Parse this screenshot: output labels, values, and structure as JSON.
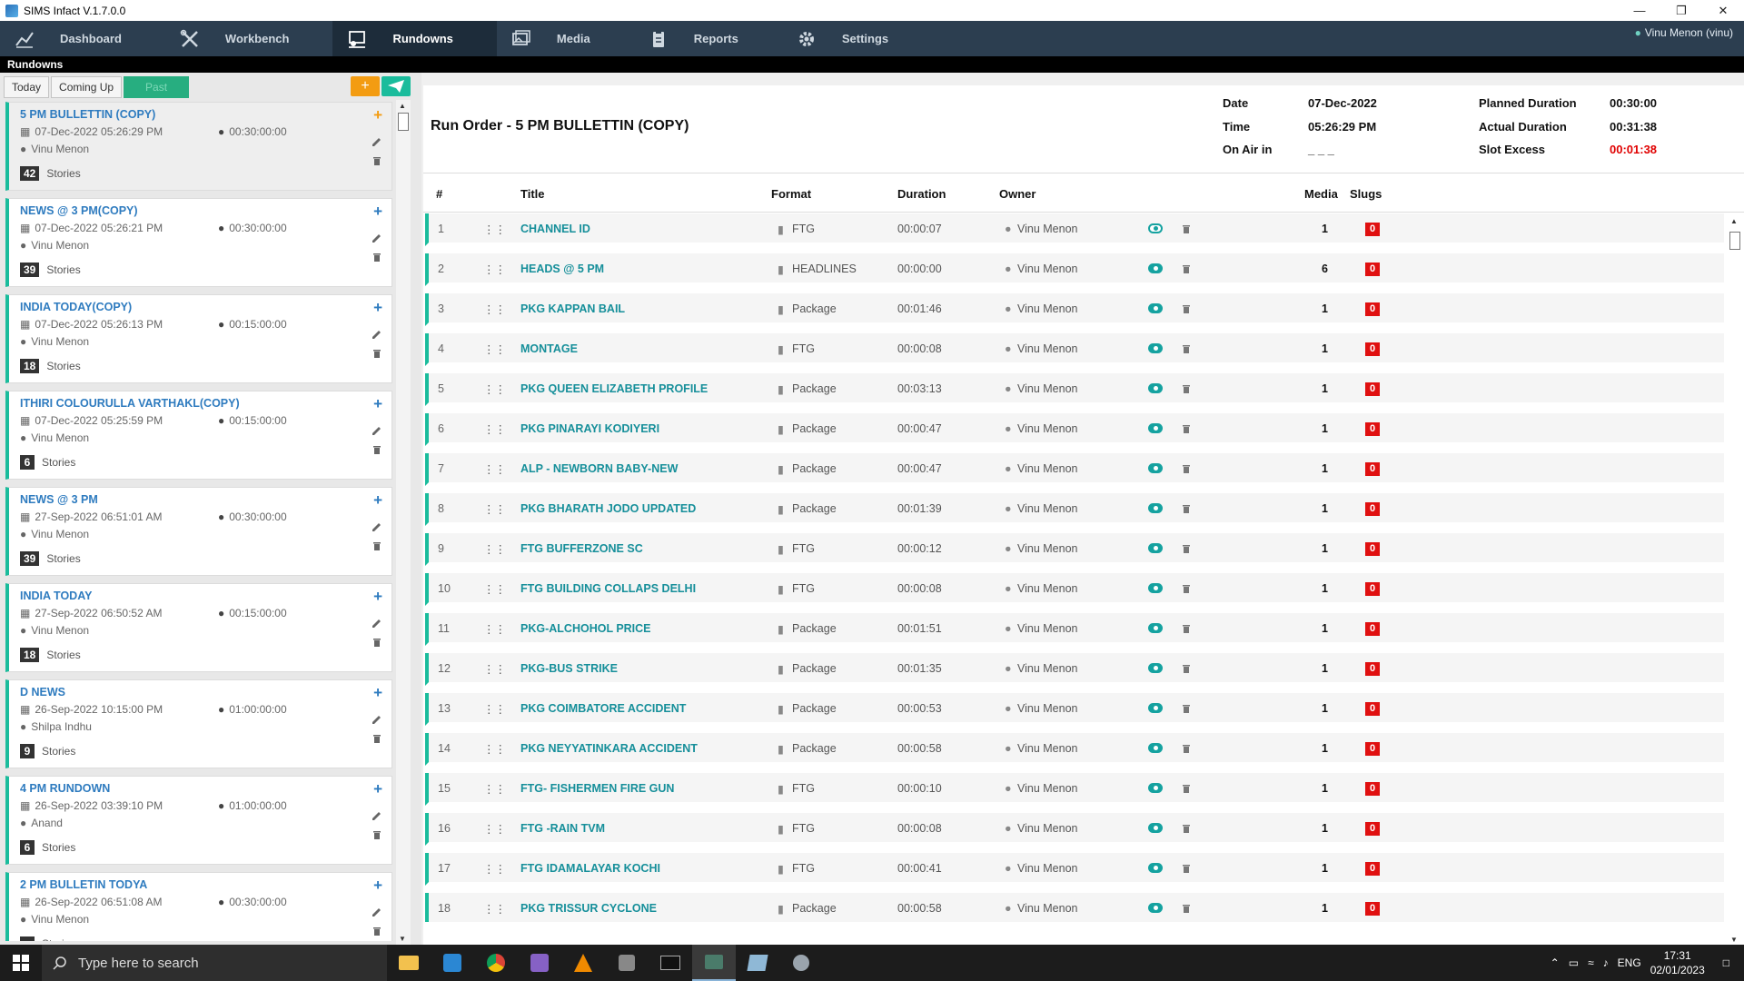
{
  "window": {
    "title": "SIMS Infact V.1.7.0.0"
  },
  "nav": {
    "items": [
      {
        "label": "Dashboard",
        "icon": "chart-icon"
      },
      {
        "label": "Workbench",
        "icon": "tools-icon"
      },
      {
        "label": "Rundowns",
        "icon": "rundown-icon"
      },
      {
        "label": "Media",
        "icon": "media-icon"
      },
      {
        "label": "Reports",
        "icon": "report-icon"
      },
      {
        "label": "Settings",
        "icon": "gear-icon"
      }
    ],
    "active": "Rundowns",
    "user": "Vinu Menon (vinu)"
  },
  "section_title": "Rundowns",
  "left": {
    "tabs": [
      "Today",
      "Coming Up",
      "Past"
    ],
    "add_label": "+",
    "stories_label": "Stories",
    "rundowns": [
      {
        "title": "5 PM BULLETTIN (COPY)",
        "date": "07-Dec-2022 05:26:29 PM",
        "duration": "00:30:00:00",
        "owner": "Vinu Menon",
        "stories": "42"
      },
      {
        "title": "NEWS @ 3 PM(COPY)",
        "date": "07-Dec-2022 05:26:21 PM",
        "duration": "00:30:00:00",
        "owner": "Vinu Menon",
        "stories": "39"
      },
      {
        "title": "INDIA TODAY(COPY)",
        "date": "07-Dec-2022 05:26:13 PM",
        "duration": "00:15:00:00",
        "owner": "Vinu Menon",
        "stories": "18"
      },
      {
        "title": "ITHIRI COLOURULLA VARTHAKL(COPY)",
        "date": "07-Dec-2022 05:25:59 PM",
        "duration": "00:15:00:00",
        "owner": "Vinu Menon",
        "stories": "6"
      },
      {
        "title": "NEWS @ 3 PM",
        "date": "27-Sep-2022 06:51:01 AM",
        "duration": "00:30:00:00",
        "owner": "Vinu Menon",
        "stories": "39"
      },
      {
        "title": "INDIA TODAY",
        "date": "27-Sep-2022 06:50:52 AM",
        "duration": "00:15:00:00",
        "owner": "Vinu Menon",
        "stories": "18"
      },
      {
        "title": "D NEWS",
        "date": "26-Sep-2022 10:15:00 PM",
        "duration": "01:00:00:00",
        "owner": "Shilpa Indhu",
        "stories": "9"
      },
      {
        "title": "4 PM RUNDOWN",
        "date": "26-Sep-2022 03:39:10 PM",
        "duration": "01:00:00:00",
        "owner": "Anand",
        "stories": "6"
      },
      {
        "title": "2 PM BULLETIN TODYA",
        "date": "26-Sep-2022 06:51:08 AM",
        "duration": "00:30:00:00",
        "owner": "Vinu Menon",
        "stories": ""
      }
    ]
  },
  "runorder": {
    "title": "Run Order - 5 PM BULLETTIN (COPY)",
    "date_label": "Date",
    "date": "07-Dec-2022",
    "time_label": "Time",
    "time": "05:26:29 PM",
    "onair_label": "On Air in",
    "onair": "_ _ _",
    "planned_label": "Planned Duration",
    "planned": "00:30:00",
    "actual_label": "Actual Duration",
    "actual": "00:31:38",
    "excess_label": "Slot Excess",
    "excess": "00:01:38",
    "columns": {
      "num": "#",
      "title": "Title",
      "format": "Format",
      "duration": "Duration",
      "owner": "Owner",
      "media": "Media",
      "slugs": "Slugs"
    },
    "stories": [
      {
        "n": "1",
        "title": "CHANNEL ID",
        "format": "FTG",
        "duration": "00:00:07",
        "owner": "Vinu Menon",
        "media": "1",
        "slugs": "0"
      },
      {
        "n": "2",
        "title": "HEADS @ 5 PM",
        "format": "HEADLINES",
        "duration": "00:00:00",
        "owner": "Vinu Menon",
        "media": "6",
        "slugs": "0"
      },
      {
        "n": "3",
        "title": "PKG KAPPAN BAIL",
        "format": "Package",
        "duration": "00:01:46",
        "owner": "Vinu Menon",
        "media": "1",
        "slugs": "0"
      },
      {
        "n": "4",
        "title": "MONTAGE",
        "format": "FTG",
        "duration": "00:00:08",
        "owner": "Vinu Menon",
        "media": "1",
        "slugs": "0"
      },
      {
        "n": "5",
        "title": "PKG QUEEN ELIZABETH PROFILE",
        "format": "Package",
        "duration": "00:03:13",
        "owner": "Vinu Menon",
        "media": "1",
        "slugs": "0"
      },
      {
        "n": "6",
        "title": "PKG PINARAYI KODIYERI",
        "format": "Package",
        "duration": "00:00:47",
        "owner": "Vinu Menon",
        "media": "1",
        "slugs": "0"
      },
      {
        "n": "7",
        "title": "ALP - NEWBORN BABY-NEW",
        "format": "Package",
        "duration": "00:00:47",
        "owner": "Vinu Menon",
        "media": "1",
        "slugs": "0"
      },
      {
        "n": "8",
        "title": "PKG BHARATH JODO UPDATED",
        "format": "Package",
        "duration": "00:01:39",
        "owner": "Vinu Menon",
        "media": "1",
        "slugs": "0"
      },
      {
        "n": "9",
        "title": "FTG BUFFERZONE SC",
        "format": "FTG",
        "duration": "00:00:12",
        "owner": "Vinu Menon",
        "media": "1",
        "slugs": "0"
      },
      {
        "n": "10",
        "title": "FTG BUILDING COLLAPS DELHI",
        "format": "FTG",
        "duration": "00:00:08",
        "owner": "Vinu Menon",
        "media": "1",
        "slugs": "0"
      },
      {
        "n": "11",
        "title": "PKG-ALCHOHOL PRICE",
        "format": "Package",
        "duration": "00:01:51",
        "owner": "Vinu Menon",
        "media": "1",
        "slugs": "0"
      },
      {
        "n": "12",
        "title": "PKG-BUS STRIKE",
        "format": "Package",
        "duration": "00:01:35",
        "owner": "Vinu Menon",
        "media": "1",
        "slugs": "0"
      },
      {
        "n": "13",
        "title": "PKG COIMBATORE ACCIDENT",
        "format": "Package",
        "duration": "00:00:53",
        "owner": "Vinu Menon",
        "media": "1",
        "slugs": "0"
      },
      {
        "n": "14",
        "title": "PKG NEYYATINKARA ACCIDENT",
        "format": "Package",
        "duration": "00:00:58",
        "owner": "Vinu Menon",
        "media": "1",
        "slugs": "0"
      },
      {
        "n": "15",
        "title": "FTG- FISHERMEN FIRE GUN",
        "format": "FTG",
        "duration": "00:00:10",
        "owner": "Vinu Menon",
        "media": "1",
        "slugs": "0"
      },
      {
        "n": "16",
        "title": "FTG -RAIN TVM",
        "format": "FTG",
        "duration": "00:00:08",
        "owner": "Vinu Menon",
        "media": "1",
        "slugs": "0"
      },
      {
        "n": "17",
        "title": "FTG IDAMALAYAR KOCHI",
        "format": "FTG",
        "duration": "00:00:41",
        "owner": "Vinu Menon",
        "media": "1",
        "slugs": "0"
      },
      {
        "n": "18",
        "title": "PKG TRISSUR CYCLONE",
        "format": "Package",
        "duration": "00:00:58",
        "owner": "Vinu Menon",
        "media": "1",
        "slugs": "0"
      }
    ]
  },
  "taskbar": {
    "search_placeholder": "Type here to search",
    "lang": "ENG",
    "time": "17:31",
    "date": "02/01/2023"
  },
  "colors": {
    "accent": "#1abc9c",
    "nav_bg": "#2c3e50",
    "title_link": "#168f9a",
    "excess": "#e00000"
  }
}
